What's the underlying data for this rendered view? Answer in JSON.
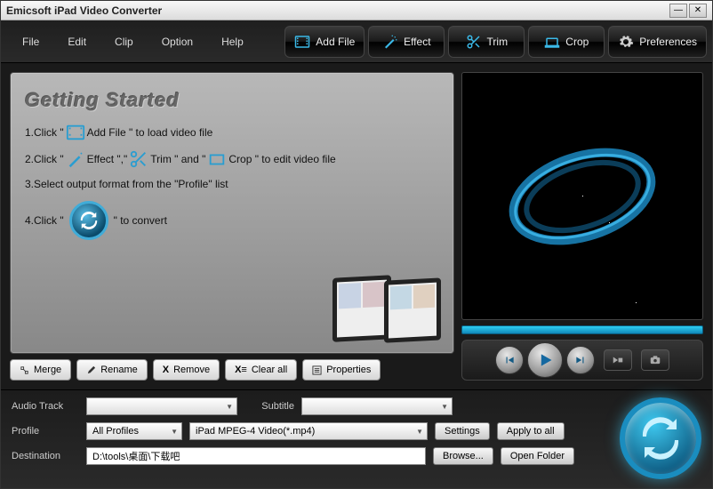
{
  "title": "Emicsoft iPad Video Converter",
  "menubar": [
    "File",
    "Edit",
    "Clip",
    "Option",
    "Help"
  ],
  "toolbar": {
    "add_file": "Add File",
    "effect": "Effect",
    "trim": "Trim",
    "crop": "Crop",
    "preferences": "Preferences"
  },
  "guide": {
    "heading": "Getting Started",
    "step1_a": "1.Click \"",
    "step1_b": "Add File \"  to load video file",
    "step2_a": "2.Click \"",
    "step2_b": "Effect \",\"",
    "step2_c": "Trim \" and \"",
    "step2_d": "Crop \" to edit video file",
    "step3": "3.Select output format from the \"Profile\" list",
    "step4_a": "4.Click \"",
    "step4_b": "\" to convert"
  },
  "actions": {
    "merge": "Merge",
    "rename": "Rename",
    "remove": "Remove",
    "clear_all": "Clear all",
    "properties": "Properties"
  },
  "bottom": {
    "audio_track_label": "Audio Track",
    "audio_track_value": "",
    "subtitle_label": "Subtitle",
    "subtitle_value": "",
    "profile_label": "Profile",
    "profile_cat": "All Profiles",
    "profile_value": "iPad MPEG-4 Video(*.mp4)",
    "settings": "Settings",
    "apply_all": "Apply to all",
    "destination_label": "Destination",
    "destination_value": "D:\\tools\\桌面\\下载吧",
    "browse": "Browse...",
    "open_folder": "Open Folder"
  }
}
